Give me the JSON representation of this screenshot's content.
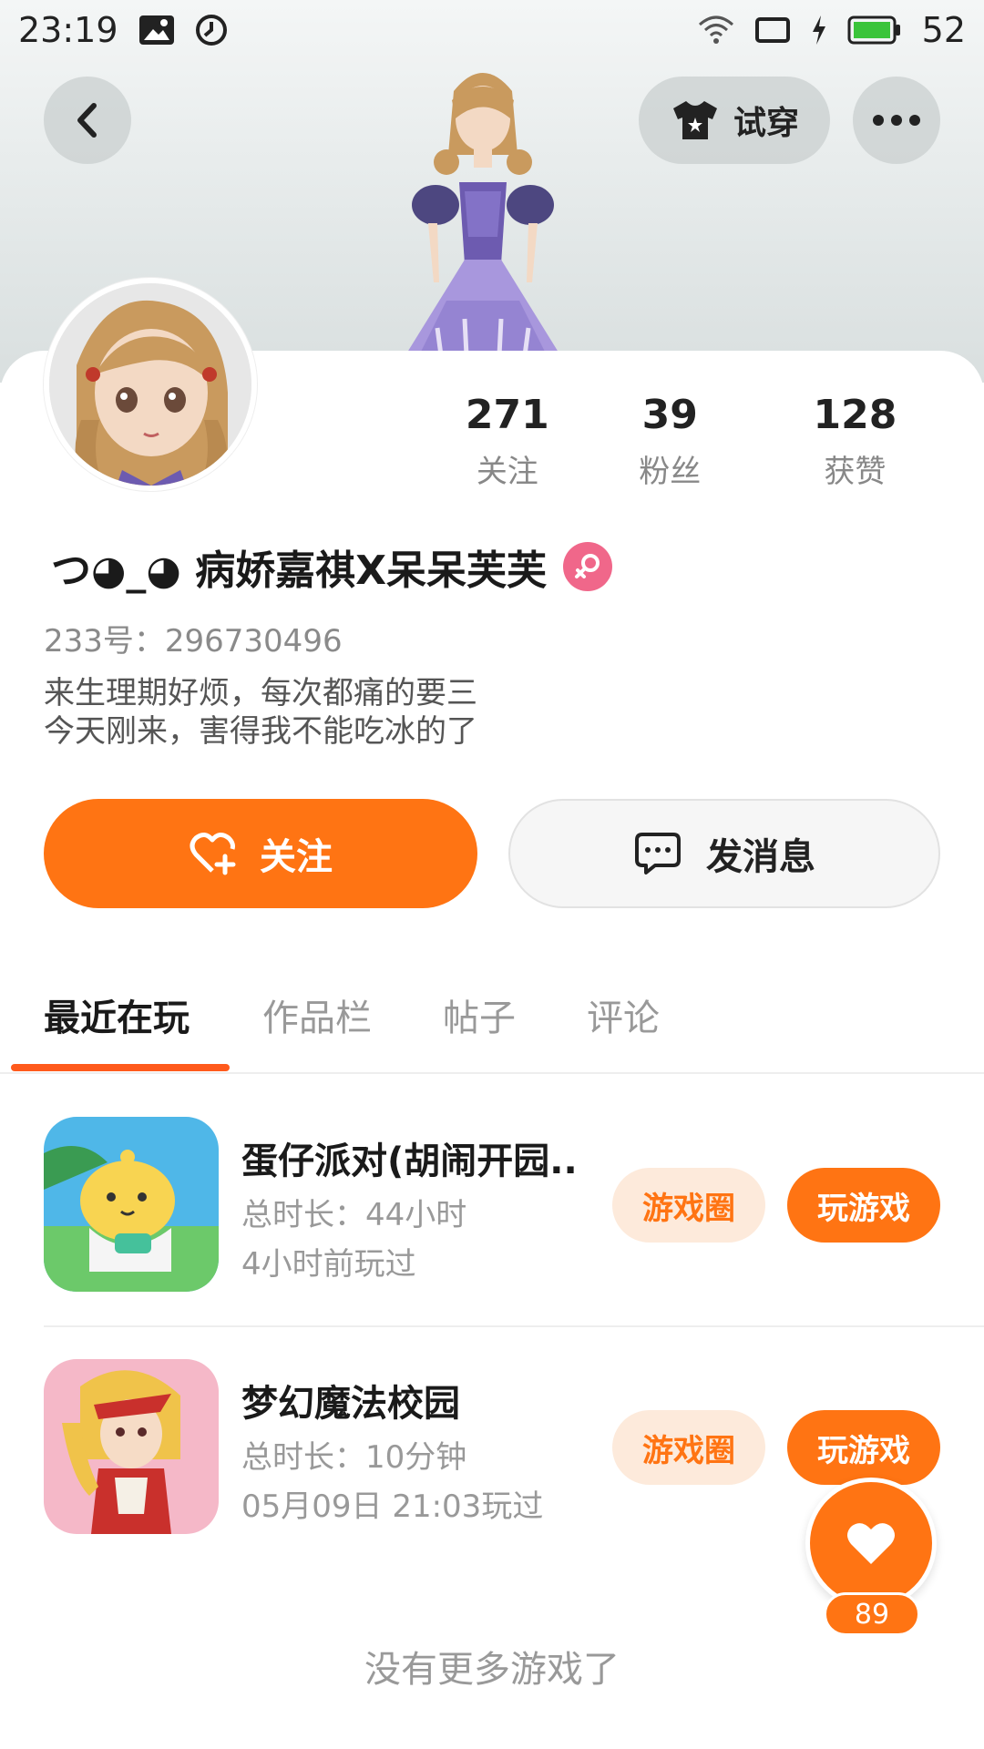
{
  "status_bar": {
    "time": "23:19",
    "battery": "52"
  },
  "header": {
    "try_on_label": "试穿"
  },
  "profile": {
    "name": "つ◕_◕ 病娇嘉祺X呆呆芙芙",
    "id_text": "233号：296730496",
    "bio_lines": [
      "来生理期好烦，每次都痛的要三",
      "今天刚来，害得我不能吃冰的了"
    ],
    "stats": [
      {
        "value": "271",
        "label": "关注"
      },
      {
        "value": "39",
        "label": "粉丝"
      },
      {
        "value": "128",
        "label": "获赞"
      }
    ]
  },
  "actions": {
    "follow_label": "关注",
    "message_label": "发消息"
  },
  "tabs": [
    {
      "label": "最近在玩",
      "active": true
    },
    {
      "label": "作品栏",
      "active": false
    },
    {
      "label": "帖子",
      "active": false
    },
    {
      "label": "评论",
      "active": false
    }
  ],
  "games": [
    {
      "title": "蛋仔派对(胡闹开园..",
      "duration": "总时长：44小时",
      "last_played": "4小时前玩过",
      "circle_label": "游戏圈",
      "play_label": "玩游戏"
    },
    {
      "title": "梦幻魔法校园",
      "duration": "总时长：10分钟",
      "last_played": "05月09日 21:03玩过",
      "circle_label": "游戏圈",
      "play_label": "玩游戏"
    }
  ],
  "footer": {
    "no_more_text": "没有更多游戏了"
  },
  "like": {
    "count": "89"
  },
  "colors": {
    "accent": "#ff7413",
    "tab_underline": "#ff5a1c",
    "gender_badge": "#f0678a"
  }
}
